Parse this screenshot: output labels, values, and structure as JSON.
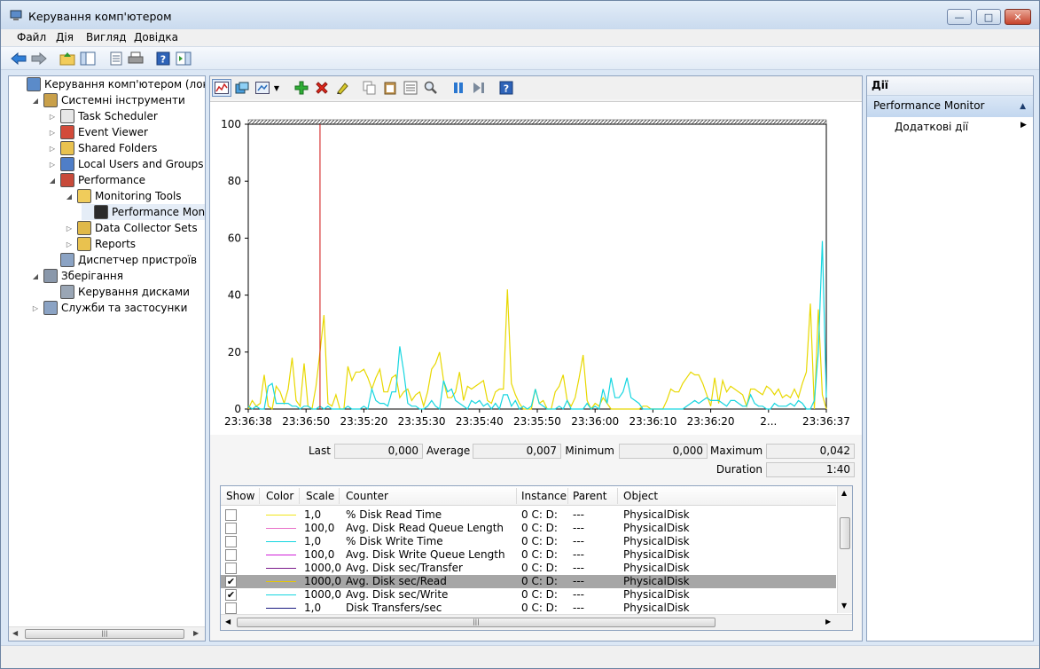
{
  "window": {
    "title": "Керування комп'ютером",
    "buttons": {
      "minimize": "—",
      "maximize": "□",
      "close": "✕"
    }
  },
  "menu": [
    "Файл",
    "Дія",
    "Вигляд",
    "Довідка"
  ],
  "tree": {
    "items": [
      {
        "label": "Керування комп'ютером (локально",
        "icon": "computer-management-icon",
        "expander": "",
        "level": 0
      },
      {
        "label": "Системні інструменти",
        "icon": "tools-icon",
        "expander": "◢",
        "level": 1
      },
      {
        "label": "Task Scheduler",
        "icon": "clock-icon",
        "expander": "▷",
        "level": 2
      },
      {
        "label": "Event Viewer",
        "icon": "event-viewer-icon",
        "expander": "▷",
        "level": 2
      },
      {
        "label": "Shared Folders",
        "icon": "shared-folder-icon",
        "expander": "▷",
        "level": 2
      },
      {
        "label": "Local Users and Groups",
        "icon": "users-icon",
        "expander": "▷",
        "level": 2
      },
      {
        "label": "Performance",
        "icon": "performance-icon",
        "expander": "◢",
        "level": 2
      },
      {
        "label": "Monitoring Tools",
        "icon": "folder-icon",
        "expander": "◢",
        "level": 3
      },
      {
        "label": "Performance Monitor",
        "icon": "performance-monitor-icon",
        "expander": "",
        "level": 4
      },
      {
        "label": "Data Collector Sets",
        "icon": "data-collector-icon",
        "expander": "▷",
        "level": 3
      },
      {
        "label": "Reports",
        "icon": "reports-icon",
        "expander": "▷",
        "level": 3
      },
      {
        "label": "Диспетчер пристроїв",
        "icon": "device-manager-icon",
        "expander": "",
        "level": 2
      },
      {
        "label": "Зберігання",
        "icon": "storage-icon",
        "expander": "◢",
        "level": 1
      },
      {
        "label": "Керування дисками",
        "icon": "disk-management-icon",
        "expander": "",
        "level": 2
      },
      {
        "label": "Служби та застосунки",
        "icon": "services-icon",
        "expander": "▷",
        "level": 1
      }
    ],
    "selected": "Performance Monitor"
  },
  "stats": {
    "last_label": "Last",
    "last": "0,000",
    "average_label": "Average",
    "average": "0,007",
    "minimum_label": "Minimum",
    "minimum": "0,000",
    "maximum_label": "Maximum",
    "maximum": "0,042",
    "duration_label": "Duration",
    "duration": "1:40"
  },
  "table": {
    "headers": [
      "Show",
      "Color",
      "Scale",
      "Counter",
      "Instance",
      "Parent",
      "Object"
    ],
    "rows": [
      {
        "show": false,
        "color": "#f2e61b",
        "scale": "1,0",
        "counter": "% Disk Read Time",
        "instance": "0 C: D:",
        "parent": "---",
        "object": "PhysicalDisk",
        "selected": false
      },
      {
        "show": false,
        "color": "#e86ec8",
        "scale": "100,0",
        "counter": "Avg. Disk Read Queue Length",
        "instance": "0 C: D:",
        "parent": "---",
        "object": "PhysicalDisk",
        "selected": false
      },
      {
        "show": false,
        "color": "#16d6e0",
        "scale": "1,0",
        "counter": "% Disk Write Time",
        "instance": "0 C: D:",
        "parent": "---",
        "object": "PhysicalDisk",
        "selected": false
      },
      {
        "show": false,
        "color": "#d020d8",
        "scale": "100,0",
        "counter": "Avg. Disk Write Queue Length",
        "instance": "0 C: D:",
        "parent": "---",
        "object": "PhysicalDisk",
        "selected": false
      },
      {
        "show": false,
        "color": "#7a1a8a",
        "scale": "1000,0",
        "counter": "Avg. Disk sec/Transfer",
        "instance": "0 C: D:",
        "parent": "---",
        "object": "PhysicalDisk",
        "selected": false
      },
      {
        "show": true,
        "color": "#e8c800",
        "scale": "1000,0",
        "counter": "Avg. Disk sec/Read",
        "instance": "0 C: D:",
        "parent": "---",
        "object": "PhysicalDisk",
        "selected": true
      },
      {
        "show": true,
        "color": "#16d6e0",
        "scale": "1000,0",
        "counter": "Avg. Disk sec/Write",
        "instance": "0 C: D:",
        "parent": "---",
        "object": "PhysicalDisk",
        "selected": false
      },
      {
        "show": false,
        "color": "#1a1a80",
        "scale": "1,0",
        "counter": "Disk Transfers/sec",
        "instance": "0 C: D:",
        "parent": "---",
        "object": "PhysicalDisk",
        "selected": false
      }
    ]
  },
  "actions": {
    "header": "Дії",
    "section": "Performance Monitor",
    "items": [
      "Додаткові дії"
    ]
  },
  "chart_data": {
    "type": "line",
    "ylim": [
      0,
      100
    ],
    "yticks": [
      "100",
      "80",
      "60",
      "40",
      "20",
      "0"
    ],
    "xticks": [
      "23:36:38",
      "23:36:50",
      "23:35:20",
      "23:35:30",
      "23:35:40",
      "23:35:50",
      "23:36:00",
      "23:36:10",
      "23:36:20",
      "2...",
      "23:36:37"
    ],
    "current_time_index": 18,
    "series": [
      {
        "color": "#e8d800",
        "values": [
          0,
          3,
          1,
          2,
          12,
          1,
          0,
          8,
          6,
          2,
          7,
          18,
          3,
          1,
          16,
          1,
          0,
          8,
          20,
          33,
          2,
          1,
          5,
          0,
          0,
          15,
          10,
          13,
          13,
          14,
          11,
          7,
          11,
          14,
          6,
          6,
          11,
          12,
          4,
          6,
          7,
          3,
          5,
          6,
          1,
          6,
          14,
          16,
          20,
          10,
          4,
          4,
          6,
          13,
          3,
          8,
          7,
          8,
          9,
          10,
          3,
          2,
          6,
          7,
          7,
          42,
          9,
          5,
          2,
          0,
          0,
          0,
          7,
          2,
          3,
          0,
          0,
          6,
          8,
          12,
          3,
          1,
          4,
          11,
          19,
          3,
          0,
          2,
          1,
          4,
          2,
          0,
          0,
          0,
          0,
          0,
          0,
          0,
          0,
          1,
          1,
          0,
          0,
          0,
          0,
          3,
          7,
          6,
          6,
          9,
          11,
          13,
          12,
          12,
          9,
          5,
          1,
          11,
          2,
          10,
          6,
          8,
          7,
          6,
          5,
          1,
          7,
          7,
          6,
          5,
          8,
          7,
          5,
          7,
          4,
          5,
          4,
          7,
          4,
          9,
          13,
          37,
          0,
          35,
          5,
          0
        ]
      },
      {
        "color": "#16d6e0",
        "values": [
          1,
          0,
          1,
          0,
          0,
          8,
          9,
          2,
          2,
          2,
          2,
          1,
          1,
          0,
          1,
          1,
          0,
          0,
          1,
          0,
          1,
          0,
          0,
          0,
          0,
          1,
          0,
          0,
          0,
          1,
          0,
          7,
          3,
          2,
          2,
          1,
          6,
          6,
          22,
          13,
          2,
          1,
          1,
          0,
          0,
          1,
          3,
          1,
          0,
          10,
          6,
          7,
          3,
          2,
          1,
          0,
          3,
          2,
          3,
          1,
          2,
          0,
          2,
          0,
          5,
          5,
          1,
          3,
          0,
          1,
          0,
          1,
          7,
          2,
          1,
          0,
          0,
          0,
          1,
          0,
          3,
          0,
          0,
          0,
          0,
          2,
          0,
          1,
          0,
          7,
          2,
          11,
          4,
          4,
          6,
          11,
          4,
          3,
          2,
          0,
          0,
          0,
          0,
          0,
          0,
          0,
          0,
          0,
          0,
          0,
          1,
          2,
          3,
          2,
          3,
          4,
          3,
          3,
          3,
          2,
          1,
          3,
          3,
          2,
          1,
          1,
          5,
          2,
          1,
          1,
          0,
          0,
          2,
          1,
          1,
          1,
          2,
          1,
          3,
          2,
          0,
          0,
          3,
          20,
          59,
          4
        ]
      }
    ]
  }
}
